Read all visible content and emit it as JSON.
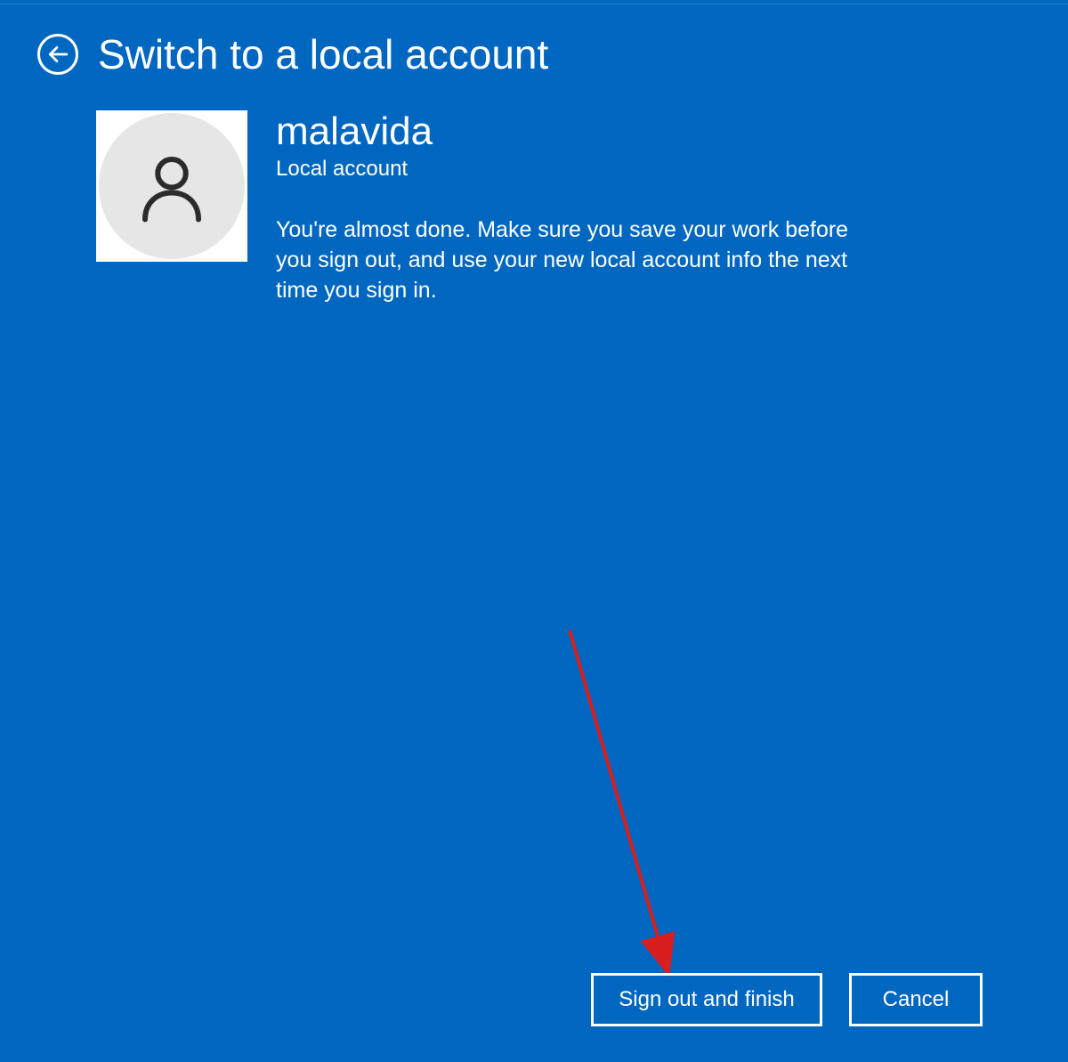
{
  "header": {
    "title": "Switch to a local account"
  },
  "account": {
    "name": "malavida",
    "type": "Local account",
    "description": "You're almost done. Make sure you save your work before you sign out, and use your new local account info the next time you sign in."
  },
  "buttons": {
    "primary": "Sign out and finish",
    "cancel": "Cancel"
  }
}
